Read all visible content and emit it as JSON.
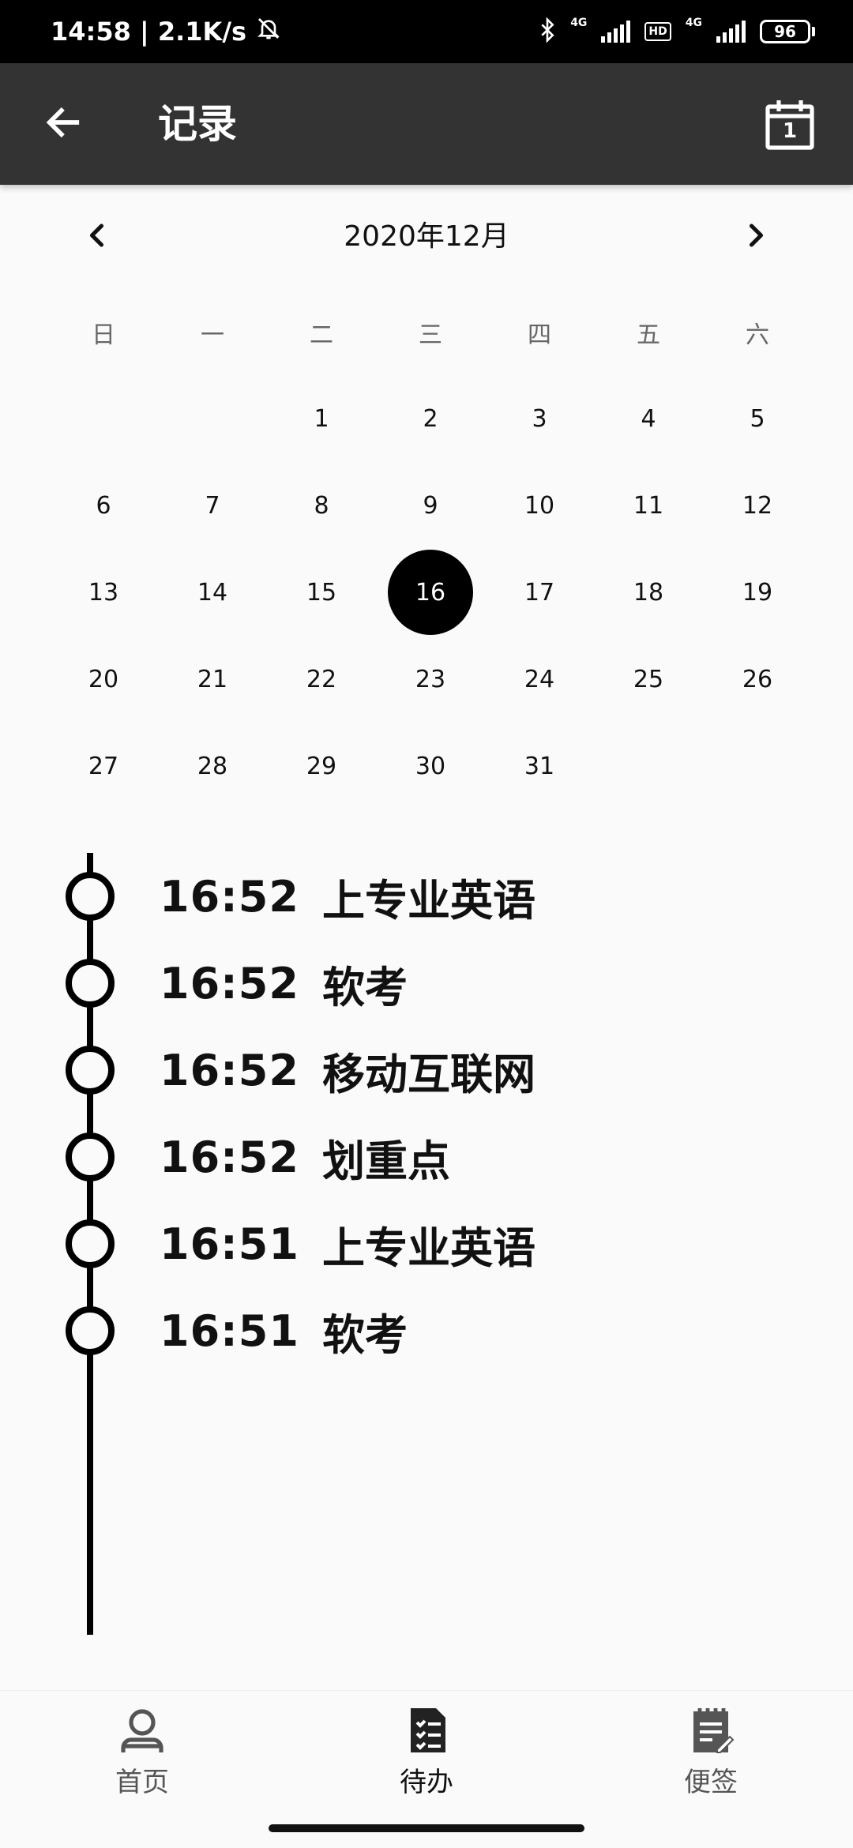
{
  "status_bar": {
    "time_speed": "14:58 | 2.1K/s",
    "network_1": "4G",
    "hd": "HD",
    "network_2": "4G",
    "battery": "96"
  },
  "app_bar": {
    "title": "记录",
    "calendar_icon_number": "1"
  },
  "calendar": {
    "month_label": "2020年12月",
    "weekdays": [
      "日",
      "一",
      "二",
      "三",
      "四",
      "五",
      "六"
    ],
    "first_weekday_index": 2,
    "days_in_month": 31,
    "selected_day": 16
  },
  "timeline": [
    {
      "time": "16:52",
      "text": "上专业英语"
    },
    {
      "time": "16:52",
      "text": "软考"
    },
    {
      "time": "16:52",
      "text": "移动互联网"
    },
    {
      "time": "16:52",
      "text": "划重点"
    },
    {
      "time": "16:51",
      "text": "上专业英语"
    },
    {
      "time": "16:51",
      "text": "软考"
    }
  ],
  "bottom_nav": {
    "home": "首页",
    "todo": "待办",
    "notes": "便签",
    "active": "todo"
  },
  "icons": {
    "back": "arrow-left-icon",
    "calendar": "calendar-icon",
    "prev": "chevron-left-icon",
    "next": "chevron-right-icon",
    "home": "person-icon",
    "todo": "checklist-icon",
    "notes": "note-edit-icon"
  },
  "colors": {
    "app_bar": "#333333",
    "selected_day": "#000000",
    "background": "#fafafa"
  }
}
